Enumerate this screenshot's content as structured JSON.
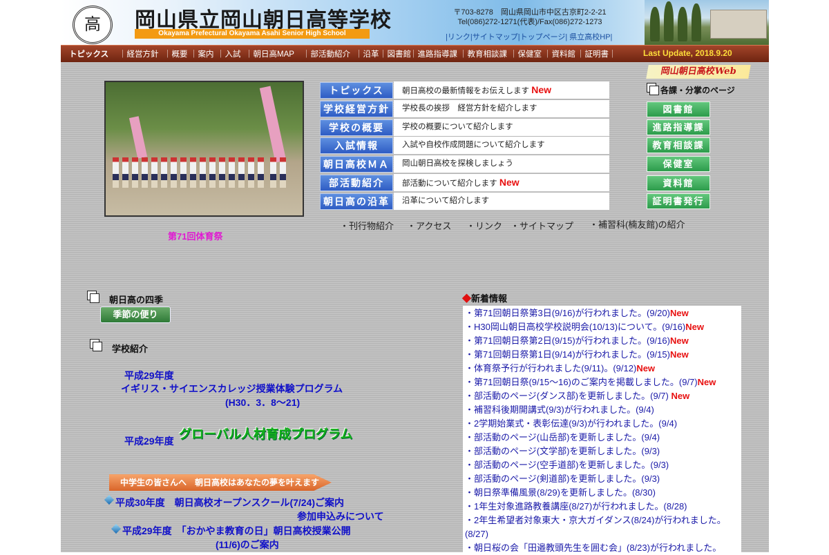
{
  "header": {
    "crest_char": "高",
    "title": "岡山県立岡山朝日高等学校",
    "subtitle_en": "Okayama Prefectural Okayama Asahi Senior High School",
    "address_line1": "〒703-8278　岡山県岡山市中区古京町2-2-21",
    "address_line2": "Tel(086)272-1271(代表)/Fax(086)272-1273",
    "links": "|リンク|サイトマップ|トップページ| 県立高校HP|"
  },
  "nav": {
    "items": [
      "トピックス",
      "経営方針",
      "概要",
      "案内",
      "入試",
      "朝日高MAP",
      "部活動紹介",
      "沿革",
      "図書館",
      "進路指導課",
      "教育相談課",
      "保健室",
      "資料館",
      "証明書"
    ],
    "last_update": "Last Update, 2018.9.20"
  },
  "hero": {
    "caption": "第71回体育祭"
  },
  "menu": [
    {
      "label": "トピックス",
      "desc": "朝日高校の最新情報をお伝えします",
      "new": "New"
    },
    {
      "label": "学校経営方針",
      "desc": "学校長の挨拶　経営方針を紹介します",
      "new": ""
    },
    {
      "label": "学校の概要",
      "desc": "学校の概要について紹介します",
      "new": ""
    },
    {
      "label": "入試情報",
      "desc": "入試や自校作成問題について紹介します",
      "new": ""
    },
    {
      "label": "朝日高校ＭＡＰ",
      "desc": "岡山朝日高校を探検しましょう",
      "new": ""
    },
    {
      "label": "部活動紹介",
      "desc": "部活動について紹介します",
      "new": "New"
    },
    {
      "label": "朝日高の沿革",
      "desc": "沿革について紹介します",
      "new": ""
    }
  ],
  "sublinks": [
    "・刊行物紹介",
    "・アクセス",
    "・リンク",
    "・サイトマップ",
    "・補習科(楠友館)の紹介"
  ],
  "right": {
    "web_badge": "岡山朝日高校Web",
    "dept_heading": "各課・分掌のページ",
    "depts": [
      "図書館",
      "進路指導課",
      "教育相談課",
      "保健室",
      "資料館",
      "証明書発行"
    ]
  },
  "left": {
    "seasons_heading": "朝日高の四季",
    "seasons_button": "季節の便り",
    "intro_heading": "学校紹介",
    "prog1_year": "平成29年度",
    "prog1_title": "イギリス・サイエンスカレッジ授業体験プログラム",
    "prog1_dates": "(H30．3．8～21)",
    "prog2_year": "平成29年度",
    "prog2_title": "グローバル人材育成プログラム",
    "banner": "中学生の皆さんへ　朝日高校はあなたの夢を叶えます",
    "oc_title": "平成30年度　朝日高校オープンスクール(7/24)ご案内",
    "oc_sub": "参加申込みについて",
    "edu_title": "平成29年度　「おかやま教育の日」朝日高校授業公開",
    "edu_sub": "(11/6)のご案内"
  },
  "news": {
    "heading": "新着情報",
    "items": [
      {
        "text": "・第71回朝日祭第3日(9/16)が行われました。(9/20)",
        "new": "New"
      },
      {
        "text": "・H30岡山朝日高校学校説明会(10/13)について。(9/16)",
        "new": "New"
      },
      {
        "text": "・第71回朝日祭第2日(9/15)が行われました。(9/16)",
        "new": "New"
      },
      {
        "text": "・第71回朝日祭第1日(9/14)が行われました。(9/15)",
        "new": "New"
      },
      {
        "text": "・体育祭予行が行われました(9/11)。(9/12)",
        "new": "New"
      },
      {
        "text": "・第71回朝日祭(9/15～16)のご案内を掲載しました。(9/7)",
        "new": "New"
      },
      {
        "text": "・部活動のページ(ダンス部)を更新しました。(9/7)",
        "new": "New"
      },
      {
        "text": "・補習科後期開講式(9/3)が行われました。(9/4)",
        "new": ""
      },
      {
        "text": "・2学期始業式・表彰伝達(9/3)が行われました。(9/4)",
        "new": ""
      },
      {
        "text": "・部活動のページ(山岳部)を更新しました。(9/4)",
        "new": ""
      },
      {
        "text": "・部活動のページ(文学部)を更新しました。(9/3)",
        "new": ""
      },
      {
        "text": "・部活動のページ(空手道部)を更新しました。(9/3)",
        "new": ""
      },
      {
        "text": "・部活動のページ(剣道部)を更新しました。(9/3)",
        "new": ""
      },
      {
        "text": "・朝日祭準備風景(8/29)を更新しました。(8/30)",
        "new": ""
      },
      {
        "text": "・1年生対象進路教養講座(8/27)が行われました。(8/28)",
        "new": ""
      },
      {
        "text": "・2年生希望者対象東大・京大ガイダンス(8/24)が行われました。(8/27)",
        "new": ""
      },
      {
        "text": "・朝日桜の会「田邉教頭先生を囲む会」(8/23)が行われました。",
        "new": ""
      }
    ]
  }
}
